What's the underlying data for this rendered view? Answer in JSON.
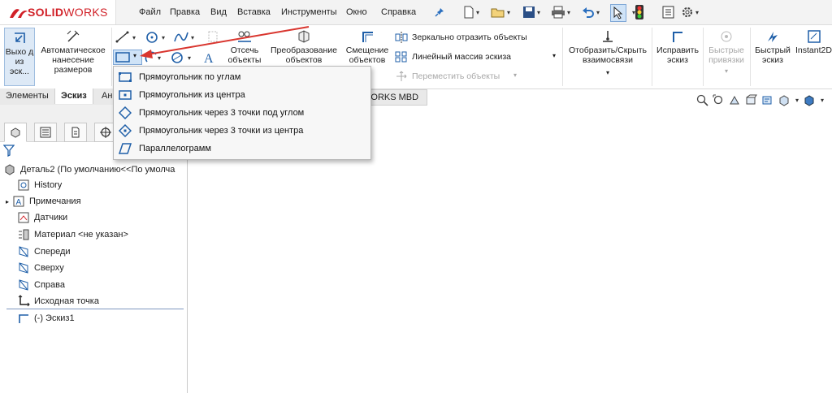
{
  "app": {
    "logo_left": "SOLID",
    "logo_right": "WORKS",
    "brand_color": "#d12027"
  },
  "menu": [
    "Файл",
    "Правка",
    "Вид",
    "Вставка",
    "Инструменты",
    "Окно",
    "Справка"
  ],
  "ribbon": {
    "exit_sketch": "Выхо д из эск...",
    "auto_dimension": "Автоматическое нанесение размеров",
    "trim": "Отсечь объекты",
    "convert": "Преобразование объектов",
    "offset": "Смещение объектов",
    "mirror": "Зеркально отразить объекты",
    "linear_pattern": "Линейный массив эскиза",
    "move": "Переместить объекты",
    "show_relations": "Отобразить/Скрыть взаимосвязи",
    "repair": "Исправить эскиз",
    "quick_snaps": "Быстрые привязки",
    "rapid_sketch": "Быстрый эскиз",
    "instant2d": "Instant2D"
  },
  "tabs": {
    "features": "Элементы",
    "sketch": "Эскиз",
    "third": "Ан",
    "mbd": "WORKS MBD"
  },
  "tree": {
    "root": "Деталь2 (По умолчанию<<По умолча",
    "items": [
      "History",
      "Примечания",
      "Датчики",
      "Материал <не указан>",
      "Спереди",
      "Сверху",
      "Справа",
      "Исходная точка",
      "(-) Эскиз1"
    ]
  },
  "dropdown": {
    "items": [
      {
        "label": "Прямоугольник по углам",
        "icon": "rect-corner-icon"
      },
      {
        "label": "Прямоугольник из центра",
        "icon": "rect-center-icon"
      },
      {
        "label": "Прямоугольник через 3 точки под углом",
        "icon": "rect-3pt-corner-icon"
      },
      {
        "label": "Прямоугольник через 3 точки из центра",
        "icon": "rect-3pt-center-icon"
      },
      {
        "label": "Параллелограмм",
        "icon": "parallelogram-icon"
      }
    ]
  },
  "colors": {
    "annotation_arrow": "#d9362f",
    "icon_blue": "#1f5fa8",
    "selected_tool": "#cfe3f7"
  }
}
